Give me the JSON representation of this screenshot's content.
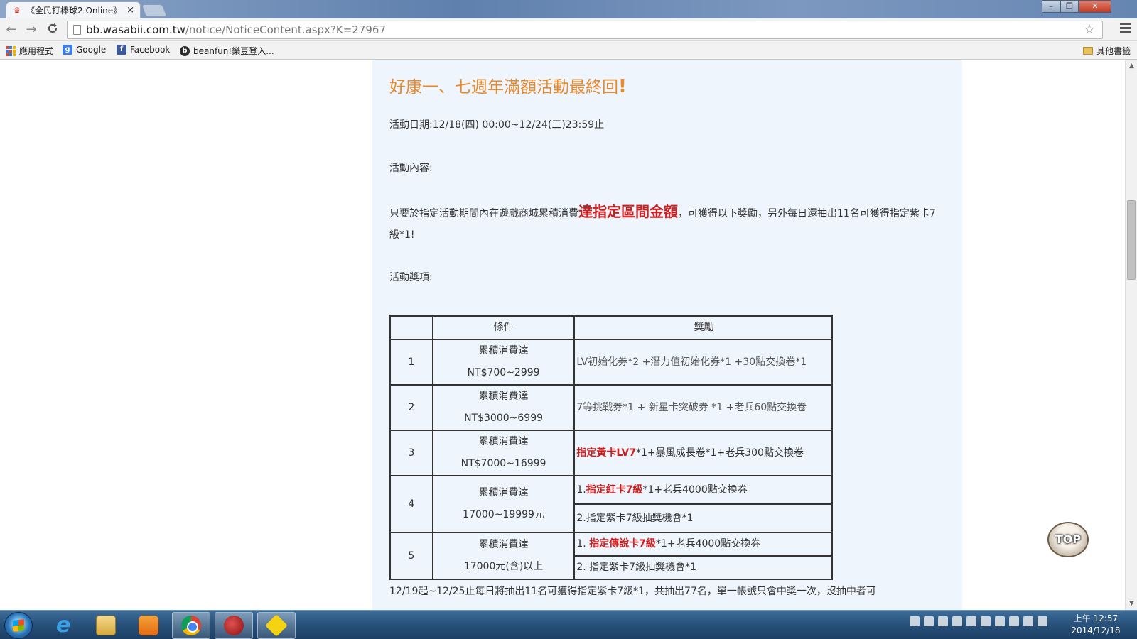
{
  "browser": {
    "tab_title": "《全民打棒球2 Online》",
    "tab_close": "×",
    "url_host": "bb.wasabii.com.tw",
    "url_path": "/notice/NoticeContent.aspx?K=27967",
    "back_icon": "←",
    "forward_icon": "→",
    "reload_icon": "C",
    "bookmarks": [
      {
        "label": "應用程式"
      },
      {
        "label": "Google"
      },
      {
        "label": "Facebook"
      },
      {
        "label": "beanfun!樂豆登入..."
      }
    ],
    "other_bookmarks": "其他書籤"
  },
  "page": {
    "headline": "好康一、七週年滿額活動最終回",
    "headline_mark": "!",
    "date_line": "活動日期:12/18(四) 00:00~12/24(三)23:59止",
    "content_label": "活動內容:",
    "desc_before": "只要於指定活動期間內在遊戲商城累積消費",
    "desc_emph": "達指定區間金額",
    "desc_after": "，可獲得以下獎勵，另外每日還抽出11名可獲得指定紫卡7級*1!",
    "prize_label": "活動獎項:",
    "table": {
      "headers": [
        "",
        "條件",
        "獎勵"
      ],
      "rows": [
        {
          "no": "1",
          "cond1": "累積消費達",
          "cond2": "NT$700~2999",
          "reward": "LV初始化券*2 +潛力值初始化券*1 +30點交換卷*1"
        },
        {
          "no": "2",
          "cond1": "累積消費達",
          "cond2": "NT$3000~6999",
          "reward": "7等挑戰券*1 + 新星卡突破券 *1 +老兵60點交換卷"
        },
        {
          "no": "3",
          "cond1": "累積消費達",
          "cond2": "NT$7000~16999",
          "reward_red": "指定黃卡LV7",
          "reward_rest": "*1+暴風成長卷*1+老兵300點交換卷"
        },
        {
          "no": "4",
          "cond1": "累積消費達",
          "cond2": "17000~19999元",
          "reward1_pre": "1.",
          "reward1_red": "指定紅卡7級",
          "reward1_rest": "*1+老兵4000點交換券",
          "reward2": "2.指定紫卡7級抽獎機會*1"
        },
        {
          "no": "5",
          "cond1": "累積消費達",
          "cond2": "17000元(含)以上",
          "reward1_pre": "1. ",
          "reward1_red": "指定傳說卡7級",
          "reward1_rest": "*1+老兵4000點交換券",
          "reward2": "2. 指定紫卡7級抽獎機會*1"
        }
      ]
    },
    "footer": "12/19起~12/25止每日將抽出11名可獲得指定紫卡7級*1，共抽出77名，單一帳號只會中獎一次，沒抽中者可",
    "top_badge": "TOP"
  },
  "taskbar": {
    "clock_period_time": "上午 12:57",
    "clock_date": "2014/12/18"
  },
  "icons": {
    "tab_favicon": "baseball-favicon",
    "omnibox_page": "page-icon",
    "bookmark_star": "star-icon",
    "menu": "hamburger-icon"
  }
}
